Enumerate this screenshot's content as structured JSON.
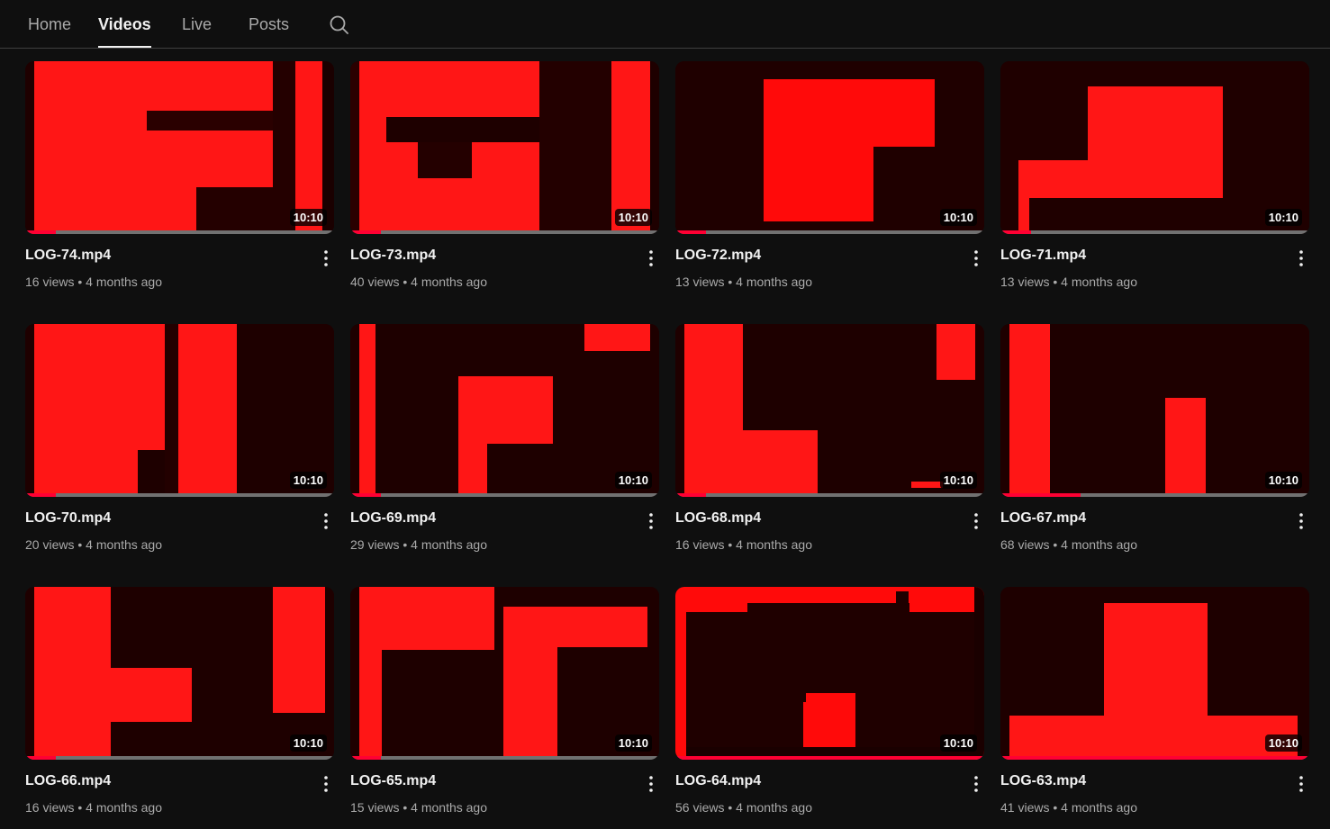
{
  "tabs": [
    {
      "label": "Home",
      "active": false
    },
    {
      "label": "Videos",
      "active": true
    },
    {
      "label": "Live",
      "active": false
    },
    {
      "label": "Posts",
      "active": false
    }
  ],
  "search_icon": "search-icon",
  "accent_color": "#ff0033",
  "videos": [
    {
      "title": "LOG-74.mp4",
      "views": "16 views",
      "age": "4 months ago",
      "duration": "10:10",
      "progress": 0.1
    },
    {
      "title": "LOG-73.mp4",
      "views": "40 views",
      "age": "4 months ago",
      "duration": "10:10",
      "progress": 0.1
    },
    {
      "title": "LOG-72.mp4",
      "views": "13 views",
      "age": "4 months ago",
      "duration": "10:10",
      "progress": 0.1
    },
    {
      "title": "LOG-71.mp4",
      "views": "13 views",
      "age": "4 months ago",
      "duration": "10:10",
      "progress": 0.1
    },
    {
      "title": "LOG-70.mp4",
      "views": "20 views",
      "age": "4 months ago",
      "duration": "10:10",
      "progress": 0.1
    },
    {
      "title": "LOG-69.mp4",
      "views": "29 views",
      "age": "4 months ago",
      "duration": "10:10",
      "progress": 0.1
    },
    {
      "title": "LOG-68.mp4",
      "views": "16 views",
      "age": "4 months ago",
      "duration": "10:10",
      "progress": 0.1
    },
    {
      "title": "LOG-67.mp4",
      "views": "68 views",
      "age": "4 months ago",
      "duration": "10:10",
      "progress": 0.26
    },
    {
      "title": "LOG-66.mp4",
      "views": "16 views",
      "age": "4 months ago",
      "duration": "10:10",
      "progress": 0.1
    },
    {
      "title": "LOG-65.mp4",
      "views": "15 views",
      "age": "4 months ago",
      "duration": "10:10",
      "progress": 0.1
    },
    {
      "title": "LOG-64.mp4",
      "views": "56 views",
      "age": "4 months ago",
      "duration": "10:10",
      "progress": 1.0
    },
    {
      "title": "LOG-63.mp4",
      "views": "41 views",
      "age": "4 months ago",
      "duration": "10:10",
      "progress": 1.0
    }
  ]
}
